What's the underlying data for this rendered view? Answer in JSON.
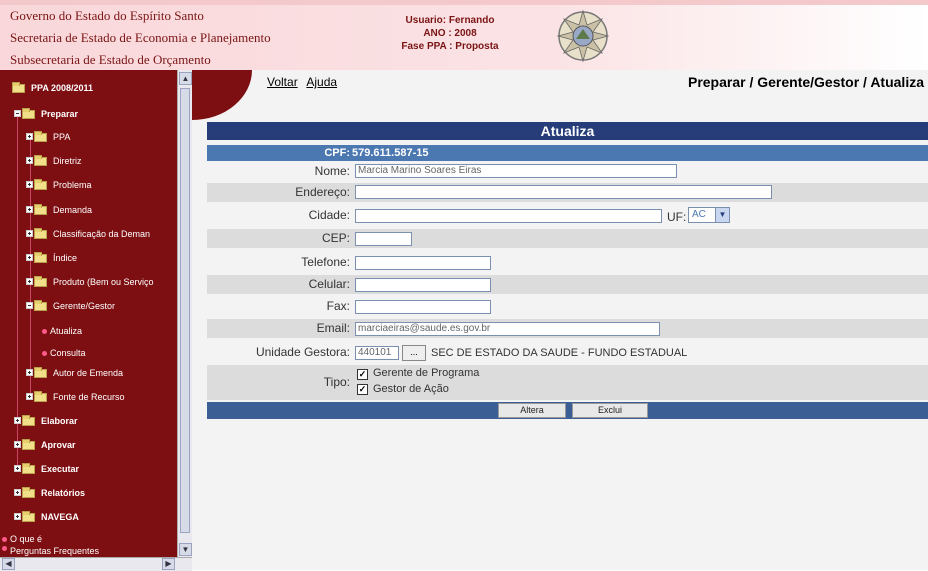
{
  "header": {
    "gov_line1": "Governo do Estado do Espírito Santo",
    "gov_line2": "Secretaria de Estado de Economia e Planejamento",
    "gov_line3": "Subsecretaria de Estado de Orçamento",
    "user_label": "Usuario: Fernando",
    "ano_label": "ANO : 2008",
    "fase_label": "Fase PPA : Proposta"
  },
  "sidebar": {
    "root": "PPA 2008/2011",
    "preparar": "Preparar",
    "items": [
      "PPA",
      "Diretriz",
      "Problema",
      "Demanda",
      "Classificação da Deman",
      "Índice",
      "Produto (Bem ou Serviço",
      "Gerente/Gestor"
    ],
    "sub_items": [
      "Atualiza",
      "Consulta"
    ],
    "items2": [
      "Autor de Emenda",
      "Fonte de Recurso"
    ],
    "top_items": [
      "Elaborar",
      "Aprovar",
      "Executar",
      "Relatórios",
      "NAVEGA"
    ],
    "bottom_links": [
      "O que é",
      "Perguntas Frequentes"
    ]
  },
  "nav": {
    "voltar": "Voltar",
    "ajuda": "Ajuda",
    "page_title": "Preparar / Gerente/Gestor / Atualiza"
  },
  "form": {
    "title": "Atualiza",
    "cpf_label": "CPF:",
    "cpf_value": "579.611.587-15",
    "nome_label": "Nome:",
    "nome_value": "Marcia Marino Soares Eiras",
    "endereco_label": "Endereço:",
    "endereco_value": "",
    "cidade_label": "Cidade:",
    "cidade_value": "",
    "uf_label": "UF:",
    "uf_value": "AC",
    "cep_label": "CEP:",
    "telefone_label": "Telefone:",
    "celular_label": "Celular:",
    "fax_label": "Fax:",
    "email_label": "Email:",
    "email_value": "marciaeiras@saude.es.gov.br",
    "unidade_label": "Unidade Gestora:",
    "unidade_code": "440101",
    "unidade_button": "...",
    "unidade_name": "SEC DE ESTADO DA SAUDE - FUNDO ESTADUAL",
    "tipo_label": "Tipo:",
    "tipo_opt1": "Gerente de Programa",
    "tipo_opt2": "Gestor de Ação",
    "altera": "Altera",
    "exclui": "Exclui"
  },
  "colors": {
    "sidebar": "#7d0f12",
    "title_bar": "#273d7a",
    "cpf_bar": "#4b78b0"
  }
}
